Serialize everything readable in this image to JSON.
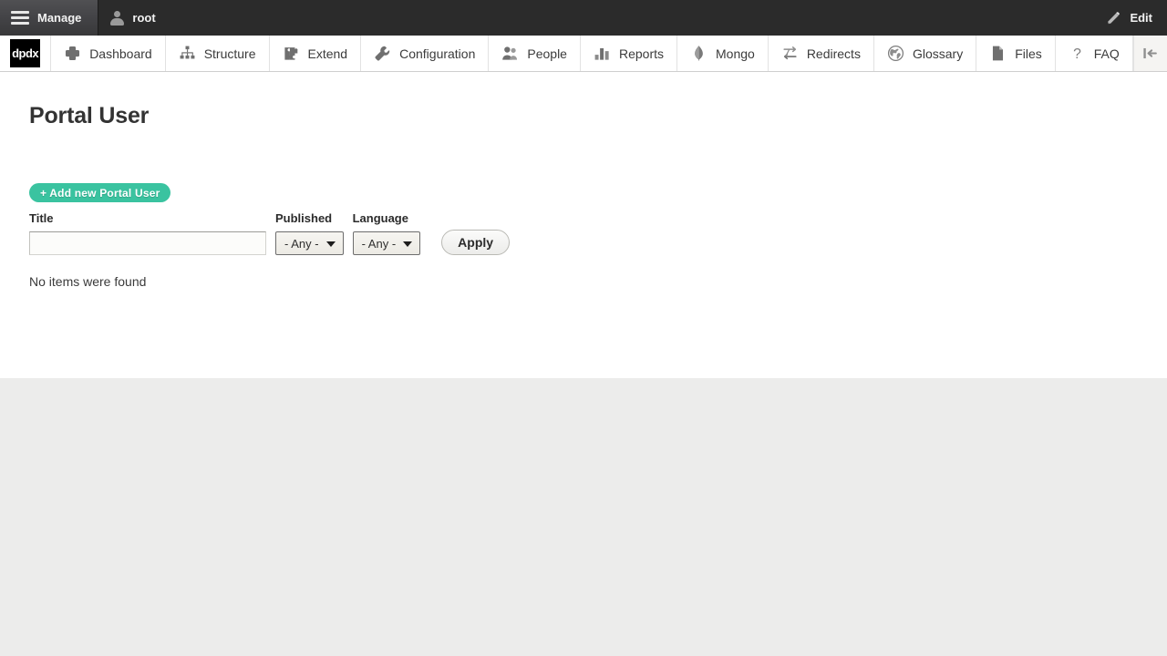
{
  "toolbar": {
    "manage_label": "Manage",
    "manage_icon": "hamburger-icon",
    "user_label": "root",
    "user_icon": "person-icon",
    "edit_label": "Edit",
    "edit_icon": "pencil-icon"
  },
  "admin_menu": {
    "logo_text": "dpdx",
    "items": [
      {
        "label": "Dashboard",
        "icon": "plus-icon"
      },
      {
        "label": "Structure",
        "icon": "sitemap-icon"
      },
      {
        "label": "Extend",
        "icon": "puzzle-piece-icon"
      },
      {
        "label": "Configuration",
        "icon": "wrench-icon"
      },
      {
        "label": "People",
        "icon": "people-icon"
      },
      {
        "label": "Reports",
        "icon": "bar-chart-icon"
      },
      {
        "label": "Mongo",
        "icon": "leaf-icon"
      },
      {
        "label": "Redirects",
        "icon": "redirect-arrows-icon"
      },
      {
        "label": "Glossary",
        "icon": "globe-icon"
      },
      {
        "label": "Files",
        "icon": "document-icon"
      },
      {
        "label": "FAQ",
        "icon": "question-mark-icon"
      }
    ],
    "orientation_toggle_icon": "collapse-left-icon"
  },
  "page": {
    "title": "Portal User",
    "add_new_label": "+ Add new Portal User",
    "accent_color": "#3ac3a0",
    "empty_message": "No items were found",
    "filters": {
      "title": {
        "label": "Title",
        "value": "",
        "placeholder": ""
      },
      "published": {
        "label": "Published",
        "value": "- Any -"
      },
      "language": {
        "label": "Language",
        "value": "- Any -"
      },
      "apply_label": "Apply"
    }
  }
}
